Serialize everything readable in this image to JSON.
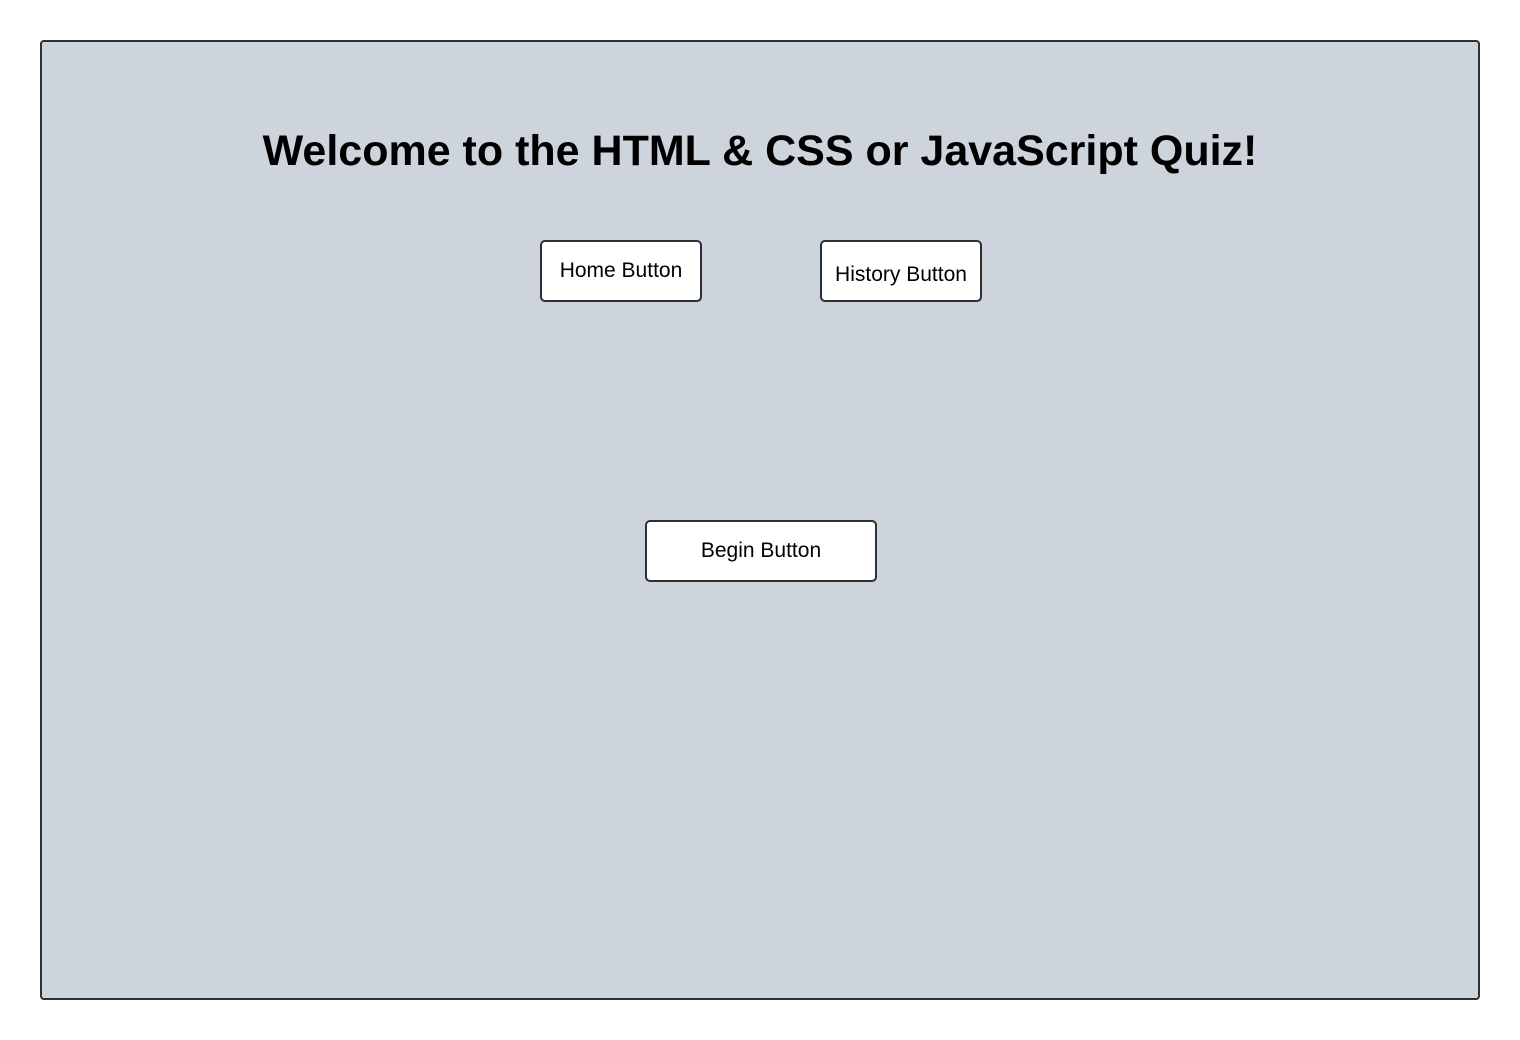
{
  "page": {
    "title": "Welcome to the HTML & CSS or JavaScript Quiz!"
  },
  "nav": {
    "home_label": "Home Button",
    "history_label": "History Button"
  },
  "main": {
    "begin_label": "Begin Button"
  },
  "colors": {
    "panel_background": "#ced4dc",
    "border": "#2b2f36",
    "button_background": "#ffffff",
    "text": "#000000"
  }
}
